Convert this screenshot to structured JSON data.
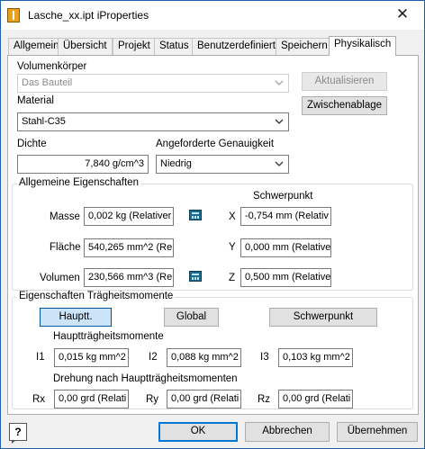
{
  "window": {
    "title": "Lasche_xx.ipt iProperties",
    "close_glyph": "✕"
  },
  "tabs": [
    {
      "label": "Allgemein"
    },
    {
      "label": "Übersicht"
    },
    {
      "label": "Projekt"
    },
    {
      "label": "Status"
    },
    {
      "label": "Benutzerdefiniert"
    },
    {
      "label": "Speichern"
    },
    {
      "label": "Physikalisch",
      "active": true
    }
  ],
  "physical": {
    "body_label": "Volumenkörper",
    "body_value": "Das Bauteil",
    "update_button": "Aktualisieren",
    "clipboard_button": "Zwischenablage",
    "material_label": "Material",
    "material_value": "Stahl-C35",
    "density_label": "Dichte",
    "density_value": "7,840 g/cm^3",
    "accuracy_label": "Angeforderte Genauigkeit",
    "accuracy_value": "Niedrig"
  },
  "general": {
    "title": "Allgemeine Eigenschaften",
    "centroid_title": "Schwerpunkt",
    "mass_label": "Masse",
    "mass_value": "0,002 kg (Relativer",
    "area_label": "Fläche",
    "area_value": "540,265 mm^2 (Re",
    "volume_label": "Volumen",
    "volume_value": "230,566 mm^3 (Re",
    "x_label": "X",
    "x_value": "-0,754 mm (Relativ",
    "y_label": "Y",
    "y_value": "0,000 mm (Relative",
    "z_label": "Z",
    "z_value": "0,500 mm (Relative"
  },
  "inertia": {
    "title": "Eigenschaften Trägheitsmomente",
    "principal_button": "Hauptt.",
    "global_button": "Global",
    "centroid_button": "Schwerpunkt",
    "principal_title": "Hauptträgheitsmomente",
    "i1_label": "I1",
    "i1_value": "0,015 kg mm^2",
    "i2_label": "I2",
    "i2_value": "0,088 kg mm^2",
    "i3_label": "I3",
    "i3_value": "0,103 kg mm^2",
    "rotation_title": "Drehung nach Hauptträgheitsmomenten",
    "rx_label": "Rx",
    "rx_value": "0,00 grd (Relati",
    "ry_label": "Ry",
    "ry_value": "0,00 grd (Relati",
    "rz_label": "Rz",
    "rz_value": "0,00 grd (Relati"
  },
  "footer": {
    "help_glyph": "?",
    "ok_button": "OK",
    "cancel_button": "Abbrechen",
    "apply_button": "Übernehmen"
  },
  "colors": {
    "accent": "#0078d7",
    "title_border": "#1f5fa8",
    "pressed": "#cce4f7"
  }
}
